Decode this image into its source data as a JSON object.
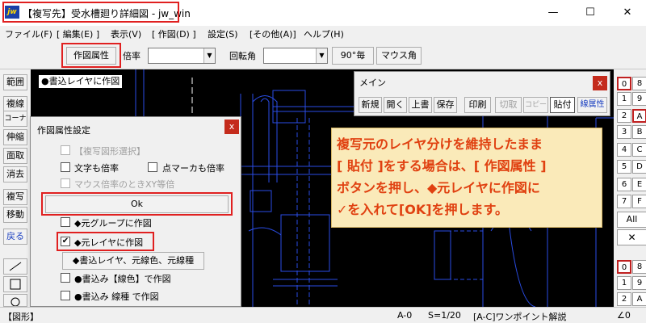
{
  "window": {
    "app_icon_text": "jw",
    "title": "【複写先】受水槽廻り詳細図 - jw_win",
    "minimize_glyph": "—",
    "maximize_glyph": "☐",
    "close_glyph": "✕"
  },
  "menu": [
    "ファイル(F)",
    "[ 編集(E) ]",
    "表示(V)",
    "[ 作図(D) ]",
    "設定(S)",
    "[その他(A)]",
    "ヘルプ(H)"
  ],
  "toolbar": {
    "draw_attr_button": "作図属性",
    "scale_label": "倍率",
    "scale_value": "",
    "rotation_label": "回転角",
    "rotation_value": "",
    "deg90_button": "90°毎",
    "mouse_angle_button": "マウス角"
  },
  "left_tools": [
    "範囲",
    "複線",
    "コーナー",
    "伸縮",
    "面取",
    "消去",
    "複写",
    "移動",
    "戻る"
  ],
  "canvas": {
    "write_layer_label": "●書込レイヤに作図"
  },
  "main_palette": {
    "title": "メイン",
    "close_glyph": "x",
    "buttons": [
      "新規",
      "開く",
      "上書",
      "保存",
      "印刷",
      "切取",
      "コピー",
      "貼付",
      "線属性"
    ]
  },
  "layer_buttons": {
    "rows": [
      [
        "0",
        "8"
      ],
      [
        "1",
        "9"
      ],
      [
        "2",
        "A"
      ],
      [
        "3",
        "B"
      ],
      [
        "4",
        "C"
      ],
      [
        "5",
        "D"
      ],
      [
        "6",
        "E"
      ],
      [
        "7",
        "F"
      ]
    ],
    "all_label": "All",
    "clear_glyph": "✕",
    "group_rows": [
      [
        "0",
        "8"
      ],
      [
        "1",
        "9"
      ],
      [
        "2",
        "A"
      ]
    ]
  },
  "dialog": {
    "title": "作図属性設定",
    "close_glyph": "x",
    "opt_fig_select": "【複写図形選択】",
    "opt_text_scale": "文字も倍率",
    "opt_point_scale": "点マーカも倍率",
    "opt_xy_equal": "マウス倍率のときXY等倍",
    "ok_button": "Ok",
    "opt_src_group": "◆元グループに作図",
    "opt_src_layer": "◆元レイヤに作図",
    "check_glyph": "✔",
    "write_layer_button": "◆書込レイヤ、元線色、元線種",
    "opt_line_color": "●書込み【線色】で作図",
    "opt_line_type": "●書込み 線種 で作図"
  },
  "annotation": {
    "line1": "複写元のレイヤ分けを維持したまま",
    "line2": "[ 貼付 ]をする場合は、[ 作図属性 ]",
    "line3": "ボタンを押し、◆元レイヤに作図に",
    "line4": "✓を入れて[OK]を押します。"
  },
  "statusbar": {
    "left": "【図形】",
    "layer": "A-0",
    "scale": "S=1/20",
    "hint": "[A-C]ワンポイント解説",
    "angle": "∠0"
  },
  "colors": {
    "highlight": "#e02020",
    "canvas": "#000000",
    "drawing_lines": "#2a4de6",
    "callout_bg": "#faeab9",
    "callout_text": "#e04010"
  }
}
